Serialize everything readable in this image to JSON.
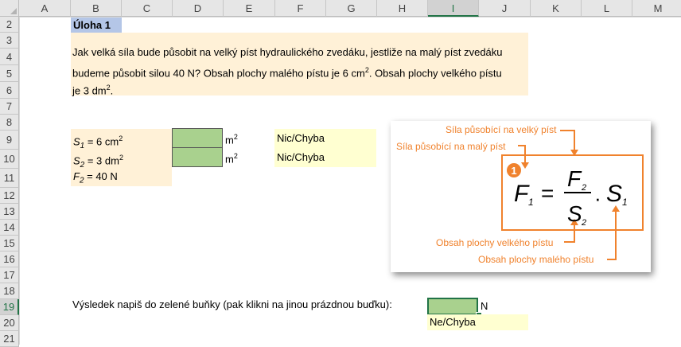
{
  "columns": [
    "A",
    "B",
    "C",
    "D",
    "E",
    "F",
    "G",
    "H",
    "I",
    "J",
    "K",
    "L",
    "M"
  ],
  "rows": [
    "2",
    "3",
    "4",
    "5",
    "6",
    "7",
    "8",
    "9",
    "10",
    "11",
    "12",
    "13",
    "14",
    "15",
    "16",
    "17",
    "18",
    "19",
    "20",
    "21"
  ],
  "selected_column": "I",
  "selected_row": "19",
  "task": {
    "title": "Úloha 1",
    "line1": "Jak velká síla bude působit na velký píst hydraulického zvedáku, jestliže na malý píst zvedáku",
    "line2_prefix": "budeme působit silou 40 N? Obsah plochy malého pístu je 6 cm",
    "line2_sup": "2",
    "line2_suffix": ". Obsah plochy velkého pístu",
    "line3_prefix": "je 3 dm",
    "line3_sup": "2",
    "line3_suffix": "."
  },
  "givens": {
    "s1_sym": "S",
    "s1_idx": "1",
    "s1_val": " = 6 cm",
    "s1_sup": "2",
    "s2_sym": "S",
    "s2_idx": "2",
    "s2_val": " = 3 dm",
    "s2_sup": "2",
    "f2_sym": "F",
    "f2_idx": "2",
    "f2_val": " = 40 N"
  },
  "conversions": {
    "unit1": "m",
    "unit1_sup": "2",
    "unit2": "m",
    "unit2_sup": "2",
    "check1": "Nic/Chyba",
    "check2": "Nic/Chyba"
  },
  "result": {
    "instruction": "Výsledek napiš do zelené buňky (pak klikni na jinou prázdnou buďku):",
    "unit": "N",
    "check": "Ne/Chyba"
  },
  "formula_image": {
    "label_big_force": "Síla působící na velký píst",
    "label_small_force": "Síla působící na malý píst",
    "label_big_area": "Obsah plochy velkého pístu",
    "label_small_area": "Obsah plochy malého pístu",
    "badge": "1",
    "F1": "F",
    "F1_idx": "1",
    "equals": "=",
    "F2": "F",
    "F2_idx": "2",
    "S2": "S",
    "S2_idx": "2",
    "dot": "·",
    "S1": "S",
    "S1_idx": "1",
    "accent_color": "#f0822d"
  }
}
